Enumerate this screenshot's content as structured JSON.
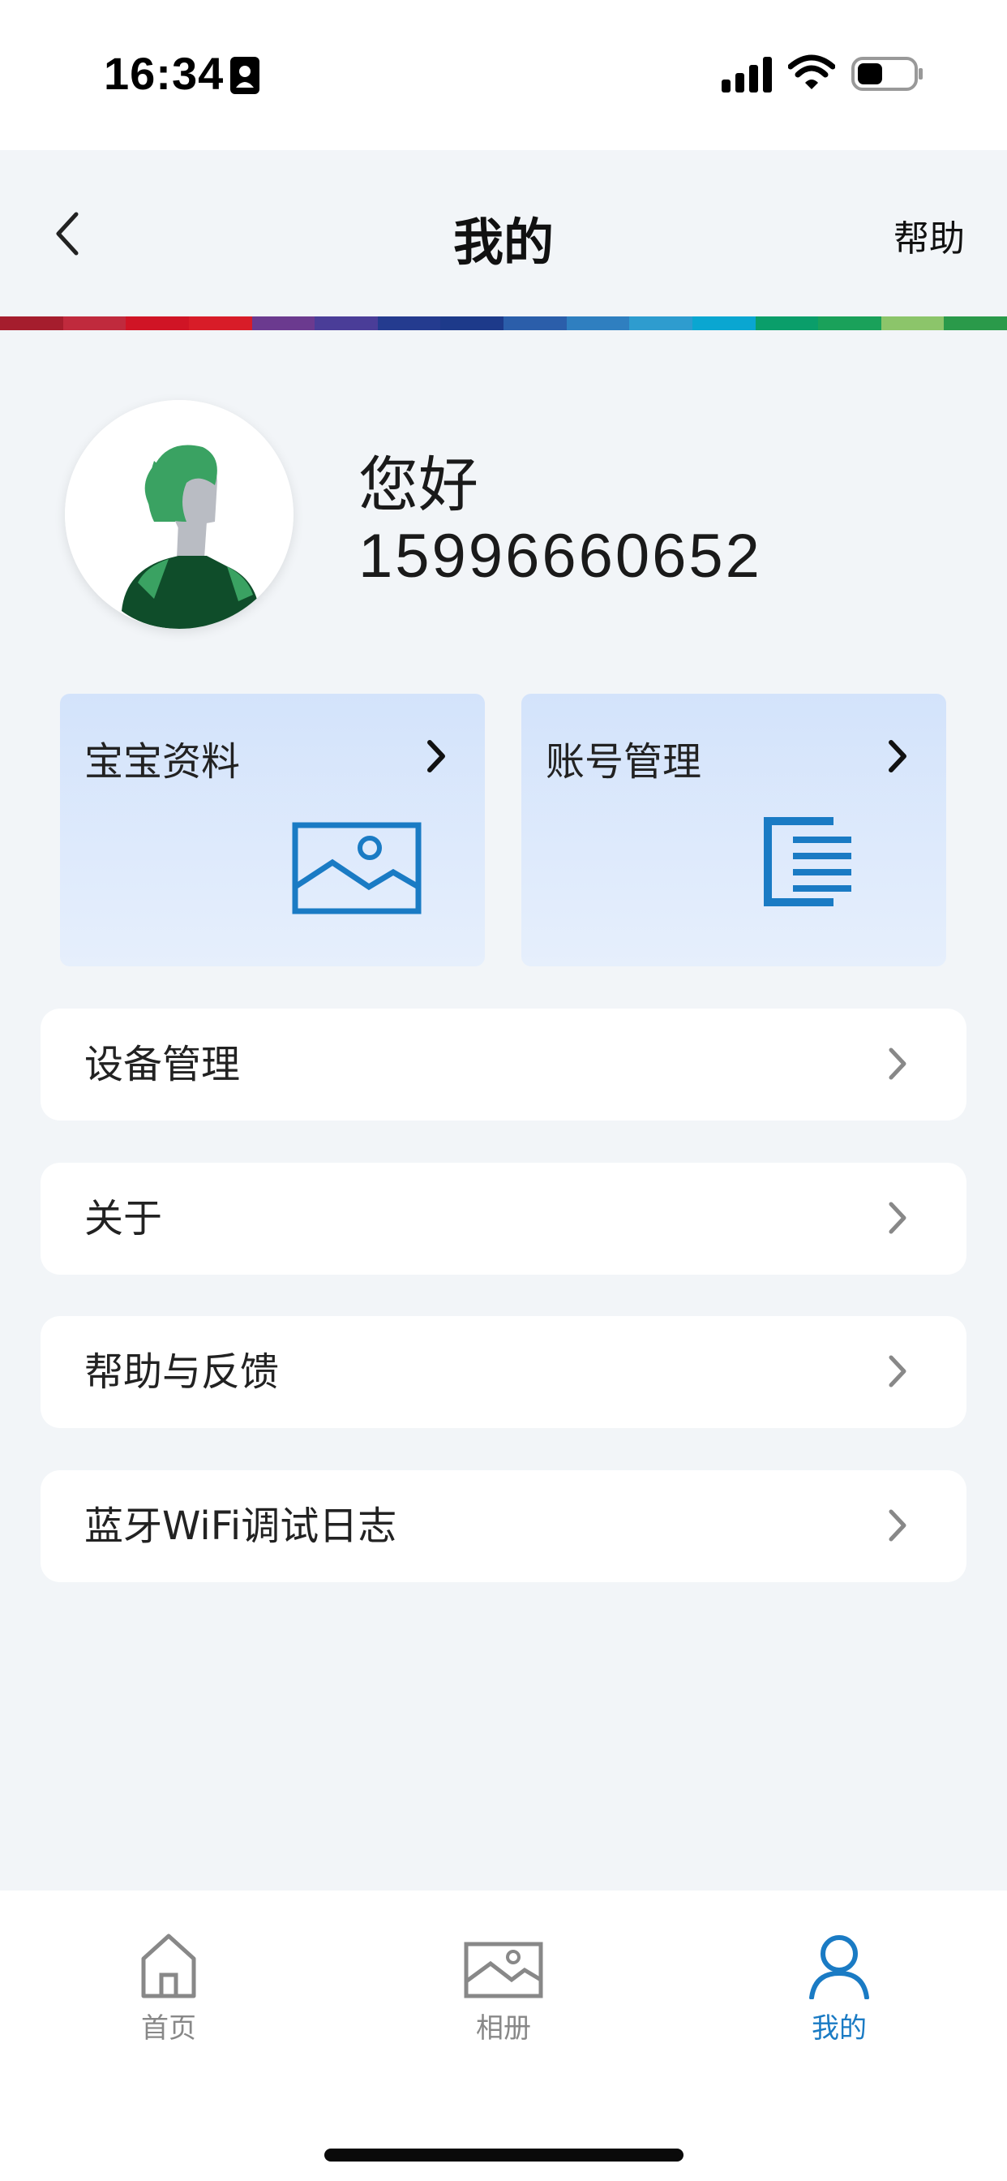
{
  "status_bar": {
    "time": "16:34"
  },
  "header": {
    "title": "我的",
    "help": "帮助"
  },
  "profile": {
    "greeting": "您好",
    "phone": "15996660652"
  },
  "cards": [
    {
      "label": "宝宝资料",
      "icon": "photo-icon"
    },
    {
      "label": "账号管理",
      "icon": "document-icon"
    }
  ],
  "menu": [
    {
      "label": "设备管理"
    },
    {
      "label": "关于"
    },
    {
      "label": "帮助与反馈"
    },
    {
      "label": "蓝牙WiFi调试日志"
    }
  ],
  "tabs": [
    {
      "label": "首页",
      "icon": "home-icon"
    },
    {
      "label": "相册",
      "icon": "album-icon"
    },
    {
      "label": "我的",
      "icon": "profile-icon"
    }
  ],
  "colors": {
    "accent": "#1a7bc4",
    "page_bg": "#f2f5f8",
    "card_bg": "#d3e3fb",
    "avatar_green": "#3aa262"
  }
}
